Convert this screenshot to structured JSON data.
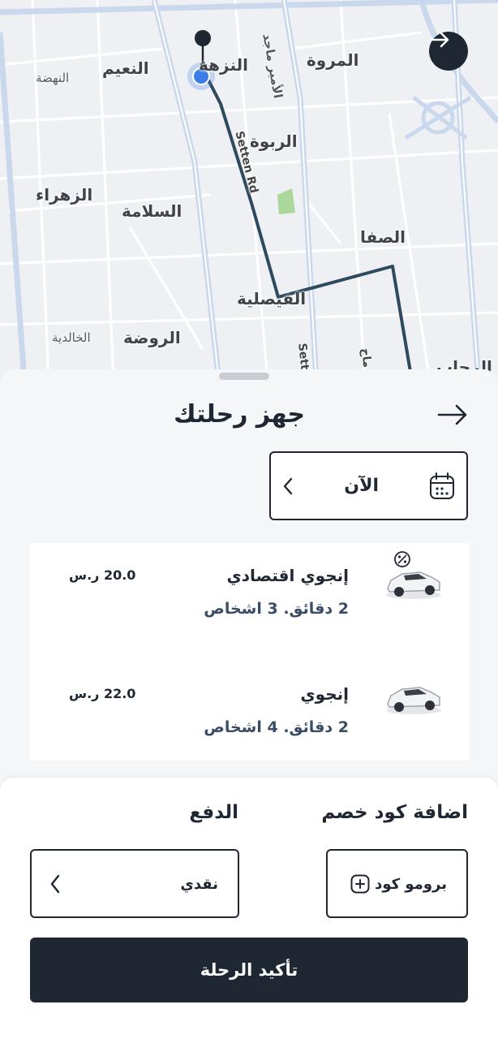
{
  "map": {
    "labels": {
      "nuzha": "النزهة",
      "marwa": "المروة",
      "naeem": "النعيم",
      "nahda": "النهضة",
      "prince": "الأمير ماجد",
      "rabwa": "الربوة",
      "zahra": "الزهراء",
      "salama": "السلامة",
      "safa": "الصفا",
      "faisaliya": "الفيصلية",
      "rawda": "الروضة",
      "khalidiya": "الخالدية",
      "settenrd": "Setten Rd",
      "sett": "Sett",
      "maj": "ماج",
      "rih": "الرحاب"
    },
    "next_icon": "arrow-right-icon"
  },
  "sheet": {
    "title": "جهز رحلتك",
    "back_icon": "arrow-right-icon",
    "time": {
      "value": "الآن",
      "icon": "calendar-icon",
      "chevron_icon": "chevron-left-icon"
    }
  },
  "rides": [
    {
      "name": "إنجوي اقتصادي",
      "meta": "2 دقائق. 3 اشخاص",
      "price": "20.0 ر.س",
      "icon": "car-discount-icon"
    },
    {
      "name": "إنجوي",
      "meta": "2 دقائق. 4 اشخاص",
      "price": "22.0 ر.س",
      "icon": "car-icon"
    }
  ],
  "promo": {
    "title": "اضافة كود خصم",
    "label": "برومو كود",
    "icon": "plus-square-icon"
  },
  "payment": {
    "title": "الدفع",
    "value": "نقدي",
    "chevron_icon": "chevron-left-icon"
  },
  "confirm": {
    "label": "تأكيد الرحلة"
  },
  "colors": {
    "primary": "#1f2733",
    "route": "#2e4a5e",
    "location": "#3d7de8",
    "park": "#a9d89a"
  }
}
